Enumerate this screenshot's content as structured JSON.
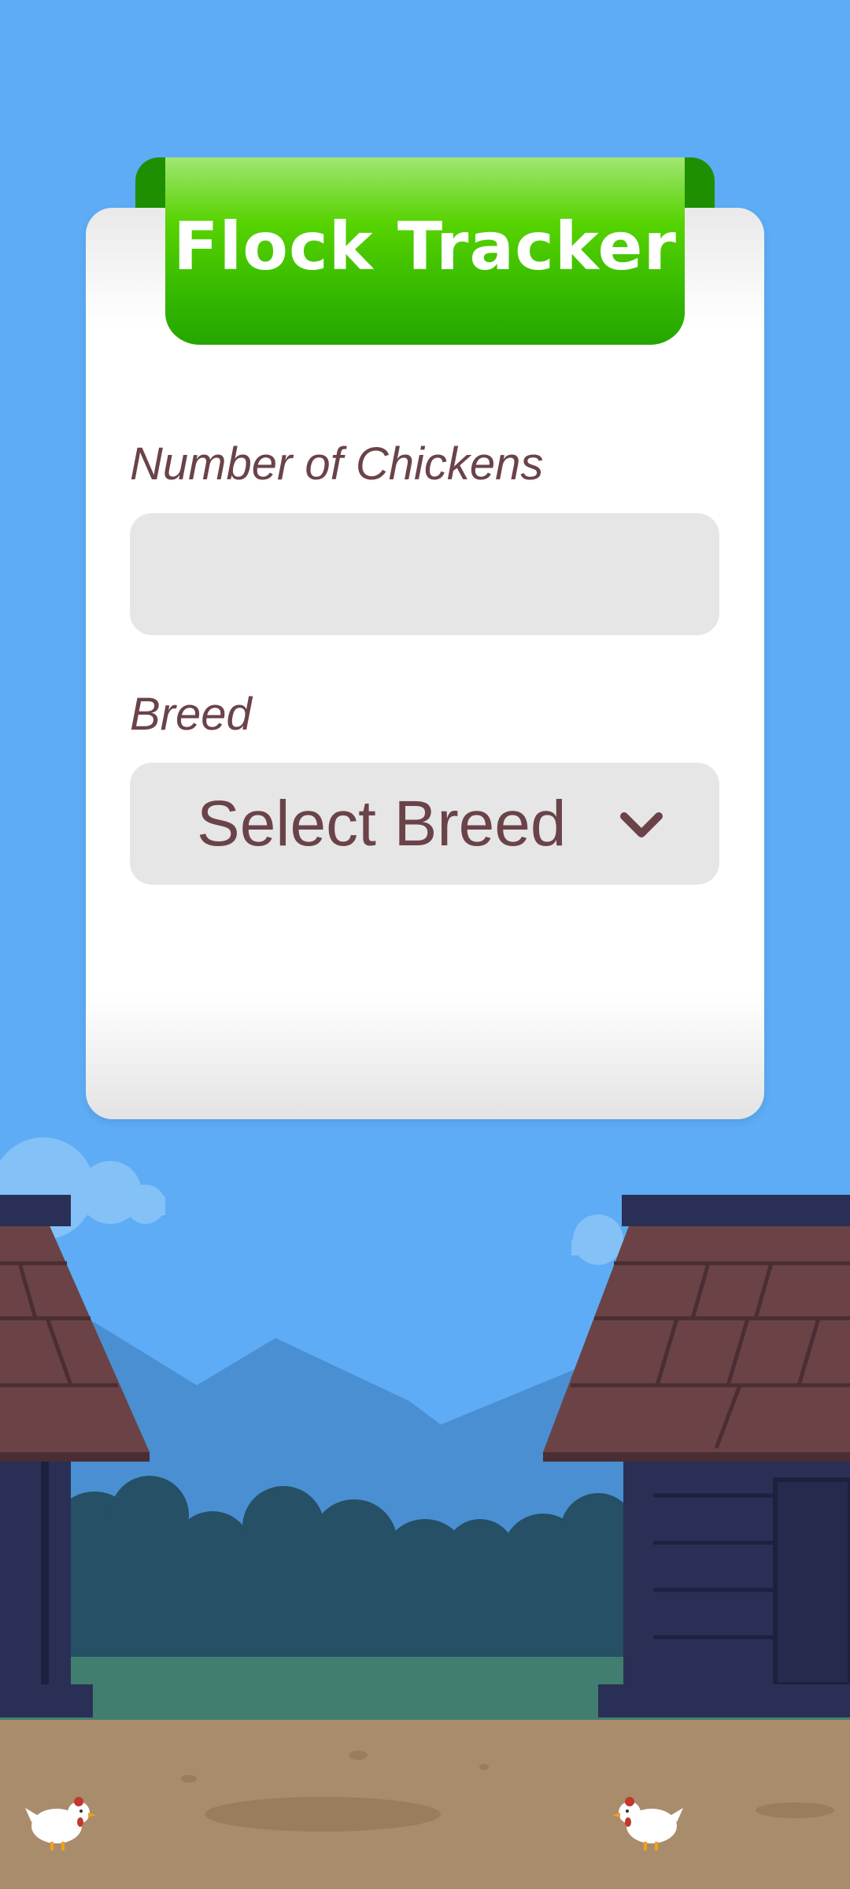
{
  "app": {
    "title": "Flock Tracker"
  },
  "form": {
    "count_label": "Number of Chickens",
    "count_value": "",
    "breed_label": "Breed",
    "breed_selected": "Select Breed"
  },
  "icons": {
    "dropdown": "chevron-down-icon",
    "chicken": "chicken-icon"
  },
  "colors": {
    "sky": "#5dacf5",
    "ribbon": "#34b700",
    "text": "#6a4348",
    "field": "#e6e6e6",
    "barn_wall": "#2a3055",
    "roof": "#6b4346",
    "ground": "#a98c6b"
  }
}
